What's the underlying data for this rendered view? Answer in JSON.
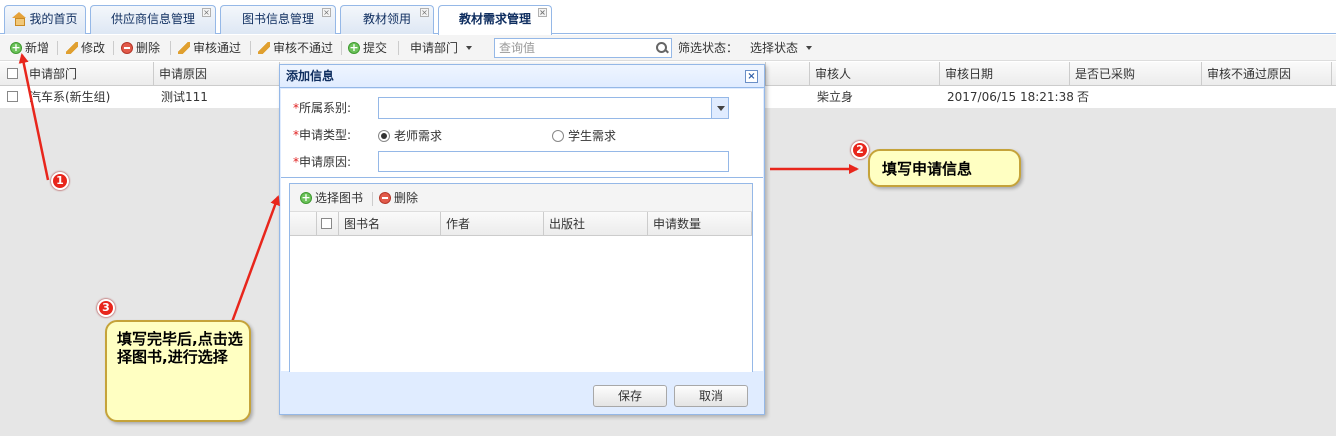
{
  "tabs": [
    {
      "label": "我的首页",
      "closable": false,
      "active": false,
      "icon": "home-icon"
    },
    {
      "label": "供应商信息管理",
      "closable": true,
      "active": false
    },
    {
      "label": "图书信息管理",
      "closable": true,
      "active": false
    },
    {
      "label": "教材领用",
      "closable": true,
      "active": false
    },
    {
      "label": "教材需求管理",
      "closable": true,
      "active": true
    }
  ],
  "toolbar": {
    "add": "新增",
    "edit": "修改",
    "delete": "删除",
    "approve": "审核通过",
    "reject": "审核不通过",
    "submit": "提交",
    "dept_select": "申请部门",
    "search_placeholder": "查询值",
    "filter_label": "筛选状态：",
    "filter_select": "选择状态"
  },
  "grid": {
    "columns": [
      "申请部门",
      "申请原因",
      "审核人",
      "审核日期",
      "是否已采购",
      "审核不通过原因"
    ],
    "rows": [
      {
        "dept": "汽车系(新生组)",
        "reason": "测试111",
        "reviewer": "柴立身",
        "review_date": "2017/06/15 18:21:38",
        "purchased": "否",
        "reject_reason": ""
      }
    ]
  },
  "dialog": {
    "title": "添加信息",
    "close_glyph": "×",
    "fields": {
      "department_label": "所属系别:",
      "department_value": "",
      "type_label": "申请类型:",
      "type_options": [
        "老师需求",
        "学生需求"
      ],
      "type_selected": "老师需求",
      "reason_label": "申请原因:",
      "reason_value": ""
    },
    "required_mark": "*",
    "books_toolbar": {
      "select": "选择图书",
      "delete": "删除"
    },
    "books_columns": [
      "图书名",
      "作者",
      "出版社",
      "申请数量"
    ],
    "buttons": {
      "save": "保存",
      "cancel": "取消"
    }
  },
  "callouts": [
    {
      "number": "1",
      "text": ""
    },
    {
      "number": "2",
      "text": "填写申请信息"
    },
    {
      "number": "3",
      "text": "填写完毕后,点击选择图书,进行选择"
    }
  ],
  "colors": {
    "accent_border": "#95b8e7",
    "callout_bg": "#ffffc2",
    "arrow": "#e8261c"
  }
}
